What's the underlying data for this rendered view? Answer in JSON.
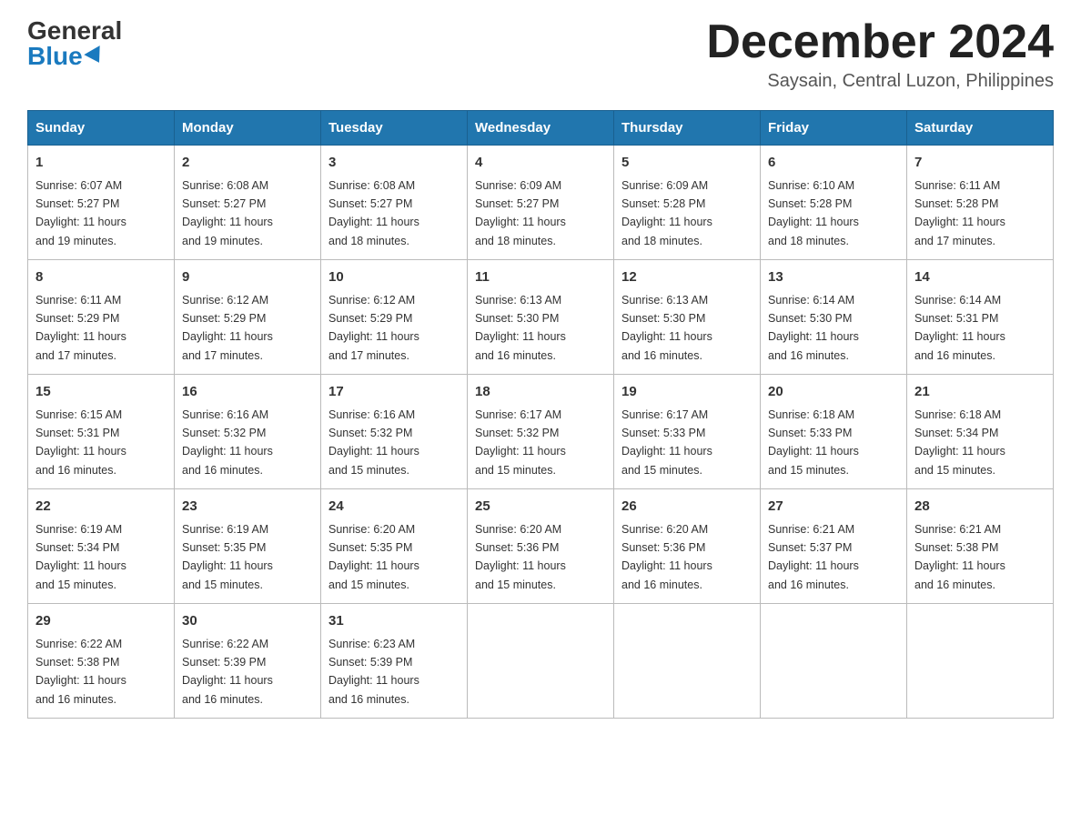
{
  "header": {
    "logo_general": "General",
    "logo_blue": "Blue",
    "month_year": "December 2024",
    "location": "Saysain, Central Luzon, Philippines"
  },
  "columns": [
    "Sunday",
    "Monday",
    "Tuesday",
    "Wednesday",
    "Thursday",
    "Friday",
    "Saturday"
  ],
  "weeks": [
    [
      {
        "day": "1",
        "sunrise": "6:07 AM",
        "sunset": "5:27 PM",
        "daylight": "11 hours and 19 minutes."
      },
      {
        "day": "2",
        "sunrise": "6:08 AM",
        "sunset": "5:27 PM",
        "daylight": "11 hours and 19 minutes."
      },
      {
        "day": "3",
        "sunrise": "6:08 AM",
        "sunset": "5:27 PM",
        "daylight": "11 hours and 18 minutes."
      },
      {
        "day": "4",
        "sunrise": "6:09 AM",
        "sunset": "5:27 PM",
        "daylight": "11 hours and 18 minutes."
      },
      {
        "day": "5",
        "sunrise": "6:09 AM",
        "sunset": "5:28 PM",
        "daylight": "11 hours and 18 minutes."
      },
      {
        "day": "6",
        "sunrise": "6:10 AM",
        "sunset": "5:28 PM",
        "daylight": "11 hours and 18 minutes."
      },
      {
        "day": "7",
        "sunrise": "6:11 AM",
        "sunset": "5:28 PM",
        "daylight": "11 hours and 17 minutes."
      }
    ],
    [
      {
        "day": "8",
        "sunrise": "6:11 AM",
        "sunset": "5:29 PM",
        "daylight": "11 hours and 17 minutes."
      },
      {
        "day": "9",
        "sunrise": "6:12 AM",
        "sunset": "5:29 PM",
        "daylight": "11 hours and 17 minutes."
      },
      {
        "day": "10",
        "sunrise": "6:12 AM",
        "sunset": "5:29 PM",
        "daylight": "11 hours and 17 minutes."
      },
      {
        "day": "11",
        "sunrise": "6:13 AM",
        "sunset": "5:30 PM",
        "daylight": "11 hours and 16 minutes."
      },
      {
        "day": "12",
        "sunrise": "6:13 AM",
        "sunset": "5:30 PM",
        "daylight": "11 hours and 16 minutes."
      },
      {
        "day": "13",
        "sunrise": "6:14 AM",
        "sunset": "5:30 PM",
        "daylight": "11 hours and 16 minutes."
      },
      {
        "day": "14",
        "sunrise": "6:14 AM",
        "sunset": "5:31 PM",
        "daylight": "11 hours and 16 minutes."
      }
    ],
    [
      {
        "day": "15",
        "sunrise": "6:15 AM",
        "sunset": "5:31 PM",
        "daylight": "11 hours and 16 minutes."
      },
      {
        "day": "16",
        "sunrise": "6:16 AM",
        "sunset": "5:32 PM",
        "daylight": "11 hours and 16 minutes."
      },
      {
        "day": "17",
        "sunrise": "6:16 AM",
        "sunset": "5:32 PM",
        "daylight": "11 hours and 15 minutes."
      },
      {
        "day": "18",
        "sunrise": "6:17 AM",
        "sunset": "5:32 PM",
        "daylight": "11 hours and 15 minutes."
      },
      {
        "day": "19",
        "sunrise": "6:17 AM",
        "sunset": "5:33 PM",
        "daylight": "11 hours and 15 minutes."
      },
      {
        "day": "20",
        "sunrise": "6:18 AM",
        "sunset": "5:33 PM",
        "daylight": "11 hours and 15 minutes."
      },
      {
        "day": "21",
        "sunrise": "6:18 AM",
        "sunset": "5:34 PM",
        "daylight": "11 hours and 15 minutes."
      }
    ],
    [
      {
        "day": "22",
        "sunrise": "6:19 AM",
        "sunset": "5:34 PM",
        "daylight": "11 hours and 15 minutes."
      },
      {
        "day": "23",
        "sunrise": "6:19 AM",
        "sunset": "5:35 PM",
        "daylight": "11 hours and 15 minutes."
      },
      {
        "day": "24",
        "sunrise": "6:20 AM",
        "sunset": "5:35 PM",
        "daylight": "11 hours and 15 minutes."
      },
      {
        "day": "25",
        "sunrise": "6:20 AM",
        "sunset": "5:36 PM",
        "daylight": "11 hours and 15 minutes."
      },
      {
        "day": "26",
        "sunrise": "6:20 AM",
        "sunset": "5:36 PM",
        "daylight": "11 hours and 16 minutes."
      },
      {
        "day": "27",
        "sunrise": "6:21 AM",
        "sunset": "5:37 PM",
        "daylight": "11 hours and 16 minutes."
      },
      {
        "day": "28",
        "sunrise": "6:21 AM",
        "sunset": "5:38 PM",
        "daylight": "11 hours and 16 minutes."
      }
    ],
    [
      {
        "day": "29",
        "sunrise": "6:22 AM",
        "sunset": "5:38 PM",
        "daylight": "11 hours and 16 minutes."
      },
      {
        "day": "30",
        "sunrise": "6:22 AM",
        "sunset": "5:39 PM",
        "daylight": "11 hours and 16 minutes."
      },
      {
        "day": "31",
        "sunrise": "6:23 AM",
        "sunset": "5:39 PM",
        "daylight": "11 hours and 16 minutes."
      },
      null,
      null,
      null,
      null
    ]
  ],
  "labels": {
    "sunrise": "Sunrise:",
    "sunset": "Sunset:",
    "daylight": "Daylight:"
  }
}
